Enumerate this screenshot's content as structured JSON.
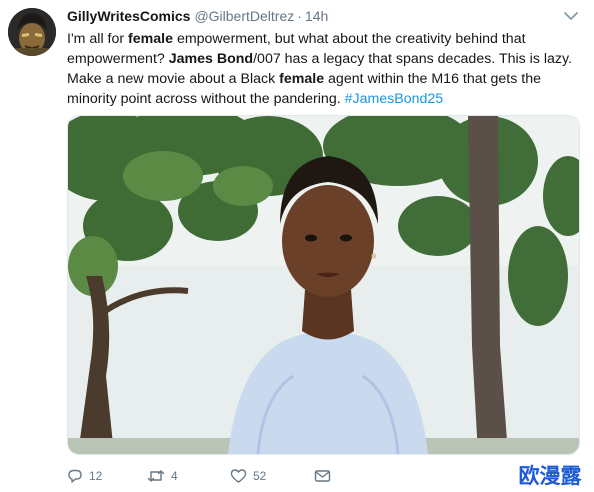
{
  "tweet": {
    "display_name": "GillyWritesComics",
    "handle": "@GilbertDeltrez",
    "separator": "·",
    "time": "14h",
    "text": {
      "s1": "I'm all for ",
      "b1": "female",
      "s2": " empowerment, but what about the creativity behind that empowerment? ",
      "b2": "James Bond",
      "s3": "/007 has a legacy that spans decades. This is lazy. Make a new movie about a Black ",
      "b3": "female",
      "s4": " agent within the M16 that gets the minority point across without the pandering. ",
      "hashtag": "#JamesBond25"
    },
    "actions": {
      "replies": "12",
      "retweets": "4",
      "likes": "52"
    },
    "icons": {
      "reply": "reply-icon",
      "retweet": "retweet-icon",
      "like": "heart-icon",
      "dm": "envelope-icon",
      "menu": "chevron-down-icon"
    },
    "colors": {
      "text": "#14171a",
      "secondary": "#657786",
      "hashtag": "#1b95e0",
      "watermark": "#1e5bd6"
    }
  },
  "watermark": {
    "text": "欧漫露"
  }
}
